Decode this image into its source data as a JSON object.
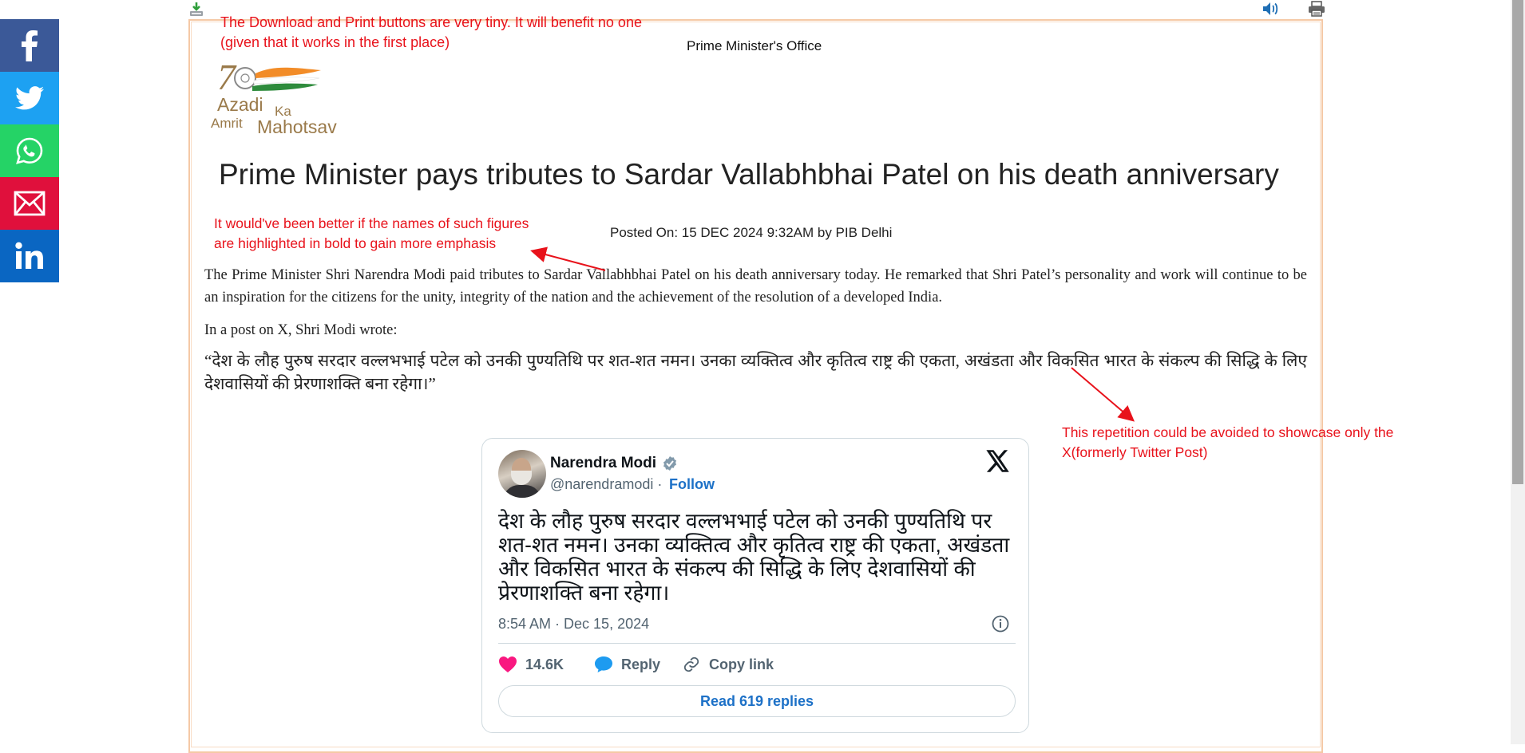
{
  "share_bar": {
    "facebook_color": "#3b5998",
    "twitter_color": "#1da1f2",
    "whatsapp_color": "#25d366",
    "email_color": "#e0103c",
    "linkedin_color": "#0a66c2"
  },
  "header": {
    "office": "Prime Minister's Office",
    "logo_lines": [
      "Azadi",
      "Ka",
      "Amrit",
      "Mahotsav"
    ]
  },
  "article": {
    "title": "Prime Minister pays tributes to Sardar Vallabhbhai Patel on his death anniversary",
    "posted": "Posted On: 15 DEC 2024 9:32AM by PIB Delhi",
    "paragraph1": "The Prime Minister Shri Narendra Modi paid tributes to Sardar Vallabhbhai Patel on his death anniversary today. He remarked that Shri Patel’s personality and work will continue to be an inspiration for the citizens for the unity, integrity of the nation and the achievement of the resolution of a developed India.",
    "paragraph2": "In a post on X, Shri Modi wrote:",
    "quote": "“देश के लौह पुरुष सरदार वल्लभभाई पटेल को उनकी पुण्यतिथि पर शत-शत नमन। उनका व्यक्तित्व और कृतित्व राष्ट्र की एकता, अखंडता और विकसित भारत के संकल्प की सिद्धि के लिए देशवासियों की प्रेरणाशक्ति बना रहेगा।”"
  },
  "annotations": {
    "note1": "The Download and Print buttons are very tiny. It will benefit no one (given that it works in the first place)",
    "note2": "It would've been better if the names of such figures are highlighted in bold to gain more emphasis",
    "note3": "This repetition could be avoided to showcase only the X(formerly Twitter Post)",
    "color": "#e8121b"
  },
  "tweet": {
    "name": "Narendra Modi",
    "handle": "@narendramodi",
    "separator": " · ",
    "follow": "Follow",
    "text": "देश के लौह पुरुष सरदार वल्लभभाई पटेल को उनकी पुण्यतिथि पर शत-शत नमन। उनका व्यक्तित्व और कृतित्व राष्ट्र की एकता, अखंडता और विकसित भारत के संकल्प की सिद्धि के लिए देशवासियों की प्रेरणाशक्ति बना रहेगा।",
    "timestamp": "8:54 AM · Dec 15, 2024",
    "likes": "14.6K",
    "reply": "Reply",
    "copy_link": "Copy link",
    "read_replies": "Read 619 replies",
    "link_color": "#1d71c7"
  }
}
